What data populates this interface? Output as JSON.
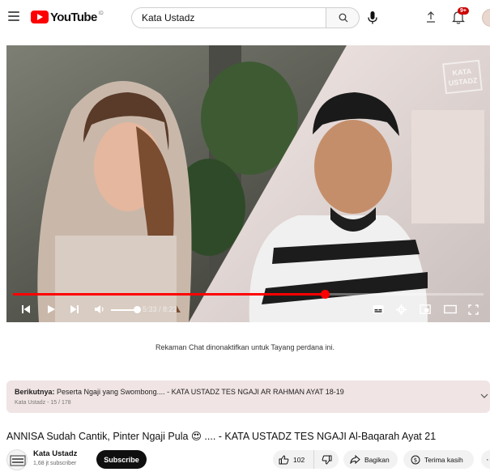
{
  "header": {
    "logo_text": "YouTube",
    "region": "ID",
    "search_value": "Kata Ustadz",
    "notification_count": "9+",
    "icons": {
      "menu": "hamburger-icon",
      "search": "search-icon",
      "mic": "microphone-icon",
      "upload": "upload-icon",
      "bell": "bell-icon"
    }
  },
  "player": {
    "watermark": "KATA USTADZ",
    "current_time": "5:33",
    "duration": "8:22",
    "time_display": "5:33 / 8:22",
    "progress": 0.6633,
    "volume": 0.9,
    "colors": {
      "progress": "#ff0000"
    }
  },
  "live_chat": {
    "message": "Rekaman Chat dinonaktifkan untuk Tayang perdana ini."
  },
  "playlist": {
    "next_label": "Berikutnya:",
    "next_title": " Peserta Ngaji yang Swombong.... - KATA USTADZ TES NGAJI AR RAHMAN AYAT 18-19",
    "meta": "Kata Ustadz - 15 / 178"
  },
  "video": {
    "title": "ANNISA Sudah Cantik, Pinter Ngaji Pula 😍 .... - KATA USTADZ TES NGAJI Al-Baqarah Ayat 21"
  },
  "owner": {
    "channel_name": "Kata Ustadz",
    "subscribers": "1,68 jt subscriber",
    "subscribe_label": "Subscribe",
    "avatar_text": "KATA USTADZ"
  },
  "actions": {
    "like_count": "102",
    "share_label": "Bagikan",
    "thanks_label": "Terima kasih",
    "more_label": "···"
  }
}
